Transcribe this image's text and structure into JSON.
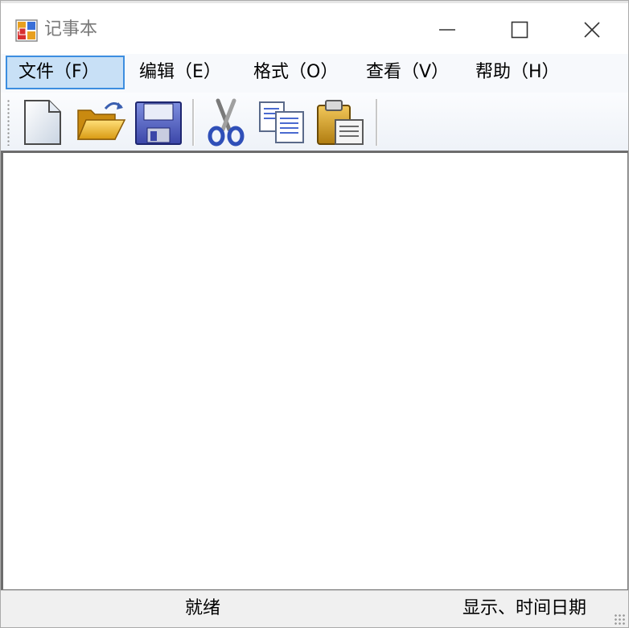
{
  "window": {
    "title": "记事本",
    "controls": {
      "minimize_icon": "minimize-icon",
      "maximize_icon": "maximize-icon",
      "close_icon": "close-icon"
    }
  },
  "menu": {
    "items": [
      {
        "label": "文件（F）",
        "active": true
      },
      {
        "label": "编辑（E）",
        "active": false
      },
      {
        "label": "格式（O）",
        "active": false
      },
      {
        "label": "查看（V）",
        "active": false
      },
      {
        "label": "帮助（H）",
        "active": false
      }
    ]
  },
  "toolbar": {
    "buttons": [
      {
        "icon": "new-document-icon"
      },
      {
        "icon": "open-folder-icon"
      },
      {
        "icon": "save-disk-icon"
      },
      {
        "icon": "cut-scissors-icon"
      },
      {
        "icon": "copy-icon"
      },
      {
        "icon": "paste-clipboard-icon"
      }
    ]
  },
  "editor": {
    "value": ""
  },
  "statusbar": {
    "ready_text": "就绪",
    "info_text": "显示、时间日期"
  },
  "colors": {
    "menu_active_bg": "#c8e0f6",
    "menu_active_border": "#3d8ee0",
    "title_text": "#7a7a7a"
  }
}
